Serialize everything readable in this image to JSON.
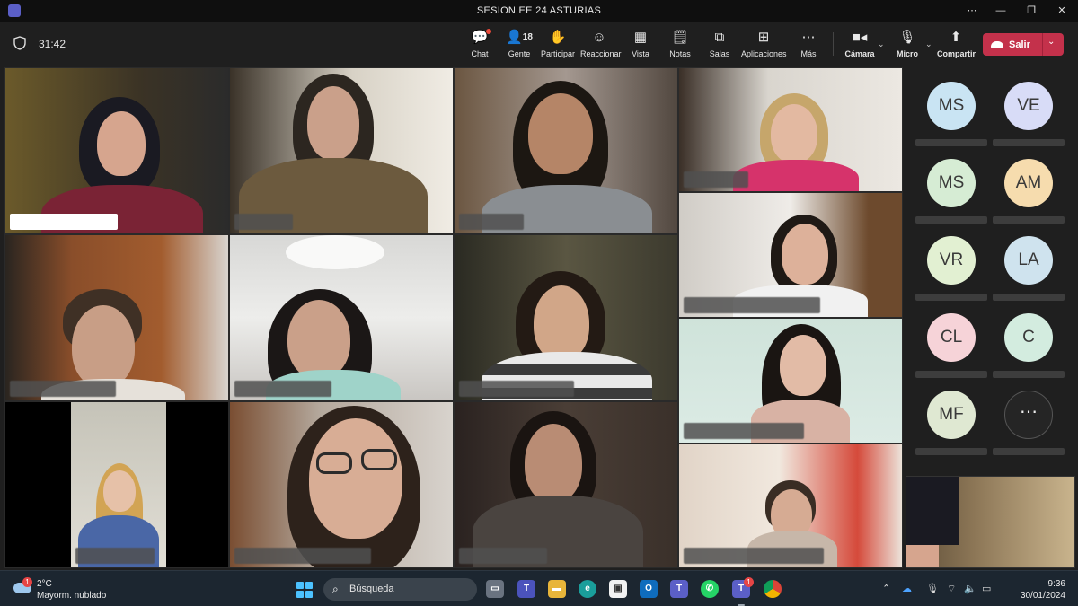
{
  "window": {
    "title": "SESION EE 24 ASTURIAS"
  },
  "toolbar": {
    "timer": "31:42",
    "chat_label": "Chat",
    "people_label": "Gente",
    "people_count": "18",
    "raise_label": "Participar",
    "react_label": "Reaccionar",
    "view_label": "Vista",
    "notes_label": "Notas",
    "rooms_label": "Salas",
    "apps_label": "Aplicaciones",
    "more_label": "Más",
    "camera_label": "Cámara",
    "mic_label": "Micro",
    "share_label": "Compartir",
    "leave_label": "Salir"
  },
  "roster": {
    "avatars": [
      {
        "initials": "MS",
        "color": "#c9e4f3"
      },
      {
        "initials": "VE",
        "color": "#d8dcf7"
      },
      {
        "initials": "MS",
        "color": "#d6ecd4"
      },
      {
        "initials": "AM",
        "color": "#f6dcae"
      },
      {
        "initials": "VR",
        "color": "#e2f0d2"
      },
      {
        "initials": "LA",
        "color": "#cfe3ee"
      },
      {
        "initials": "CL",
        "color": "#f6d3d8"
      },
      {
        "initials": "C",
        "color": "#d3ecdf"
      },
      {
        "initials": "MF",
        "color": "#dfe8d2"
      }
    ],
    "more_icon": "ellipsis-icon"
  },
  "taskbar": {
    "weather_badge": "1",
    "temperature": "2°C",
    "condition": "Mayorm. nublado",
    "search_placeholder": "Búsqueda",
    "teams_badge": "1",
    "time": "9:36",
    "date": "30/01/2024"
  }
}
